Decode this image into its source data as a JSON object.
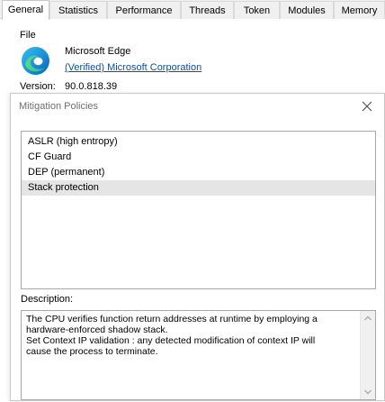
{
  "tabs": [
    {
      "label": "General"
    },
    {
      "label": "Statistics"
    },
    {
      "label": "Performance"
    },
    {
      "label": "Threads"
    },
    {
      "label": "Token"
    },
    {
      "label": "Modules"
    },
    {
      "label": "Memory"
    }
  ],
  "file": {
    "group_label": "File",
    "app_name": "Microsoft Edge",
    "verified_text": "(Verified) Microsoft Corporation",
    "version_label": "Version:",
    "version_value": "90.0.818.39"
  },
  "dialog": {
    "title": "Mitigation Policies",
    "policies": [
      {
        "label": "ASLR (high entropy)"
      },
      {
        "label": "CF Guard"
      },
      {
        "label": "DEP (permanent)"
      },
      {
        "label": "Stack protection"
      }
    ],
    "selected_policy": "Stack protection",
    "description_label": "Description:",
    "description_lines": [
      "The CPU verifies function return addresses at runtime by employing a",
      "hardware-enforced shadow stack.",
      "Set Context IP validation : any detected modification of context IP will",
      "cause the process to terminate."
    ]
  },
  "icons": {
    "app": "microsoft-edge-icon",
    "close": "close-icon",
    "scroll_up": "chevron-up-icon",
    "scroll_down": "chevron-down-icon"
  },
  "colors": {
    "link": "#0a51a1",
    "selected_row": "#e5e5e5"
  }
}
